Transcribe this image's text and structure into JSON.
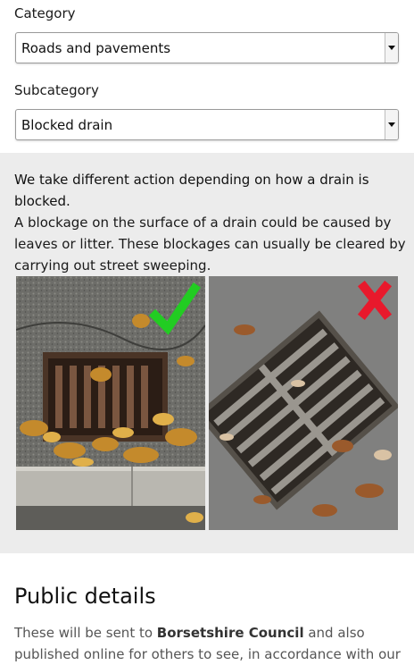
{
  "category": {
    "label": "Category",
    "value": "Roads and pavements"
  },
  "subcategory": {
    "label": "Subcategory",
    "value": "Blocked drain"
  },
  "notice": {
    "title": "We take different action depending on how a drain is blocked.",
    "text": "A blockage on the surface of a drain could be caused by leaves or litter. These blockages can usually be cleared by carrying out street sweeping.",
    "photos": [
      {
        "name": "surface-blockage-photo",
        "mark": "check-icon",
        "mark_color": "#22cc22"
      },
      {
        "name": "deep-blockage-photo",
        "mark": "cross-icon",
        "mark_color": "#e8192c"
      }
    ]
  },
  "public_details": {
    "heading": "Public details",
    "text_before": "These will be sent to ",
    "council": "Borsetshire Council",
    "text_after": " and also published online for others to see, in accordance with our"
  }
}
